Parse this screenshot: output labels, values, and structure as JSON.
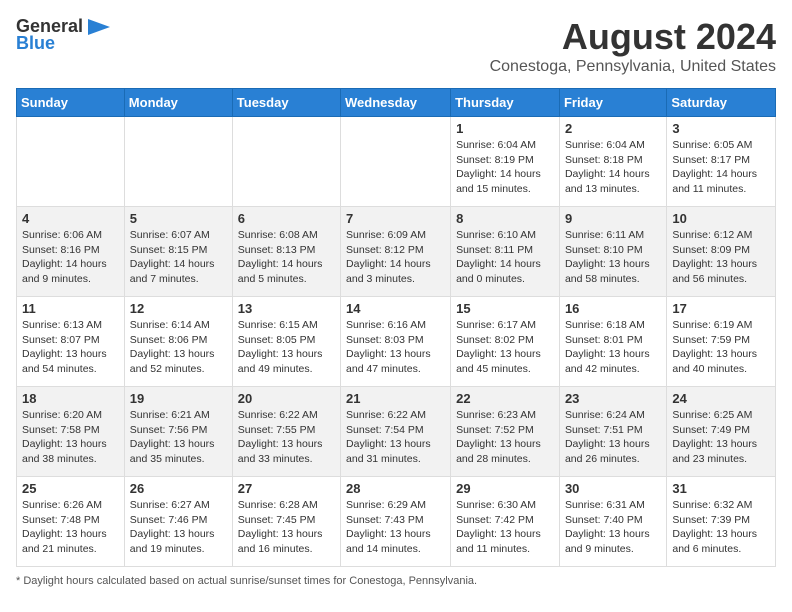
{
  "logo": {
    "general": "General",
    "blue": "Blue"
  },
  "title": "August 2024",
  "subtitle": "Conestoga, Pennsylvania, United States",
  "days_of_week": [
    "Sunday",
    "Monday",
    "Tuesday",
    "Wednesday",
    "Thursday",
    "Friday",
    "Saturday"
  ],
  "weeks": [
    [
      {
        "day": "",
        "info": ""
      },
      {
        "day": "",
        "info": ""
      },
      {
        "day": "",
        "info": ""
      },
      {
        "day": "",
        "info": ""
      },
      {
        "day": "1",
        "info": "Sunrise: 6:04 AM\nSunset: 8:19 PM\nDaylight: 14 hours and 15 minutes."
      },
      {
        "day": "2",
        "info": "Sunrise: 6:04 AM\nSunset: 8:18 PM\nDaylight: 14 hours and 13 minutes."
      },
      {
        "day": "3",
        "info": "Sunrise: 6:05 AM\nSunset: 8:17 PM\nDaylight: 14 hours and 11 minutes."
      }
    ],
    [
      {
        "day": "4",
        "info": "Sunrise: 6:06 AM\nSunset: 8:16 PM\nDaylight: 14 hours and 9 minutes."
      },
      {
        "day": "5",
        "info": "Sunrise: 6:07 AM\nSunset: 8:15 PM\nDaylight: 14 hours and 7 minutes."
      },
      {
        "day": "6",
        "info": "Sunrise: 6:08 AM\nSunset: 8:13 PM\nDaylight: 14 hours and 5 minutes."
      },
      {
        "day": "7",
        "info": "Sunrise: 6:09 AM\nSunset: 8:12 PM\nDaylight: 14 hours and 3 minutes."
      },
      {
        "day": "8",
        "info": "Sunrise: 6:10 AM\nSunset: 8:11 PM\nDaylight: 14 hours and 0 minutes."
      },
      {
        "day": "9",
        "info": "Sunrise: 6:11 AM\nSunset: 8:10 PM\nDaylight: 13 hours and 58 minutes."
      },
      {
        "day": "10",
        "info": "Sunrise: 6:12 AM\nSunset: 8:09 PM\nDaylight: 13 hours and 56 minutes."
      }
    ],
    [
      {
        "day": "11",
        "info": "Sunrise: 6:13 AM\nSunset: 8:07 PM\nDaylight: 13 hours and 54 minutes."
      },
      {
        "day": "12",
        "info": "Sunrise: 6:14 AM\nSunset: 8:06 PM\nDaylight: 13 hours and 52 minutes."
      },
      {
        "day": "13",
        "info": "Sunrise: 6:15 AM\nSunset: 8:05 PM\nDaylight: 13 hours and 49 minutes."
      },
      {
        "day": "14",
        "info": "Sunrise: 6:16 AM\nSunset: 8:03 PM\nDaylight: 13 hours and 47 minutes."
      },
      {
        "day": "15",
        "info": "Sunrise: 6:17 AM\nSunset: 8:02 PM\nDaylight: 13 hours and 45 minutes."
      },
      {
        "day": "16",
        "info": "Sunrise: 6:18 AM\nSunset: 8:01 PM\nDaylight: 13 hours and 42 minutes."
      },
      {
        "day": "17",
        "info": "Sunrise: 6:19 AM\nSunset: 7:59 PM\nDaylight: 13 hours and 40 minutes."
      }
    ],
    [
      {
        "day": "18",
        "info": "Sunrise: 6:20 AM\nSunset: 7:58 PM\nDaylight: 13 hours and 38 minutes."
      },
      {
        "day": "19",
        "info": "Sunrise: 6:21 AM\nSunset: 7:56 PM\nDaylight: 13 hours and 35 minutes."
      },
      {
        "day": "20",
        "info": "Sunrise: 6:22 AM\nSunset: 7:55 PM\nDaylight: 13 hours and 33 minutes."
      },
      {
        "day": "21",
        "info": "Sunrise: 6:22 AM\nSunset: 7:54 PM\nDaylight: 13 hours and 31 minutes."
      },
      {
        "day": "22",
        "info": "Sunrise: 6:23 AM\nSunset: 7:52 PM\nDaylight: 13 hours and 28 minutes."
      },
      {
        "day": "23",
        "info": "Sunrise: 6:24 AM\nSunset: 7:51 PM\nDaylight: 13 hours and 26 minutes."
      },
      {
        "day": "24",
        "info": "Sunrise: 6:25 AM\nSunset: 7:49 PM\nDaylight: 13 hours and 23 minutes."
      }
    ],
    [
      {
        "day": "25",
        "info": "Sunrise: 6:26 AM\nSunset: 7:48 PM\nDaylight: 13 hours and 21 minutes."
      },
      {
        "day": "26",
        "info": "Sunrise: 6:27 AM\nSunset: 7:46 PM\nDaylight: 13 hours and 19 minutes."
      },
      {
        "day": "27",
        "info": "Sunrise: 6:28 AM\nSunset: 7:45 PM\nDaylight: 13 hours and 16 minutes."
      },
      {
        "day": "28",
        "info": "Sunrise: 6:29 AM\nSunset: 7:43 PM\nDaylight: 13 hours and 14 minutes."
      },
      {
        "day": "29",
        "info": "Sunrise: 6:30 AM\nSunset: 7:42 PM\nDaylight: 13 hours and 11 minutes."
      },
      {
        "day": "30",
        "info": "Sunrise: 6:31 AM\nSunset: 7:40 PM\nDaylight: 13 hours and 9 minutes."
      },
      {
        "day": "31",
        "info": "Sunrise: 6:32 AM\nSunset: 7:39 PM\nDaylight: 13 hours and 6 minutes."
      }
    ]
  ],
  "footer": "Daylight hours"
}
